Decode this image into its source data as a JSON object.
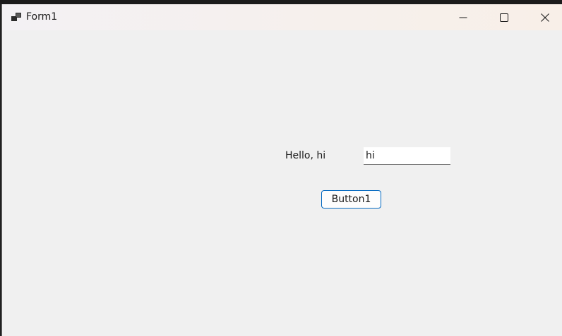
{
  "window": {
    "title": "Form1",
    "app_icon": "winforms-app-icon",
    "caption_buttons": [
      "minimize-icon",
      "maximize-icon",
      "close-icon"
    ]
  },
  "form": {
    "label_text": "Hello, hi",
    "textbox_value": "hi",
    "button_label": "Button1"
  },
  "colors": {
    "button_border": "#0067c0",
    "client_background": "#f0f0f0"
  }
}
